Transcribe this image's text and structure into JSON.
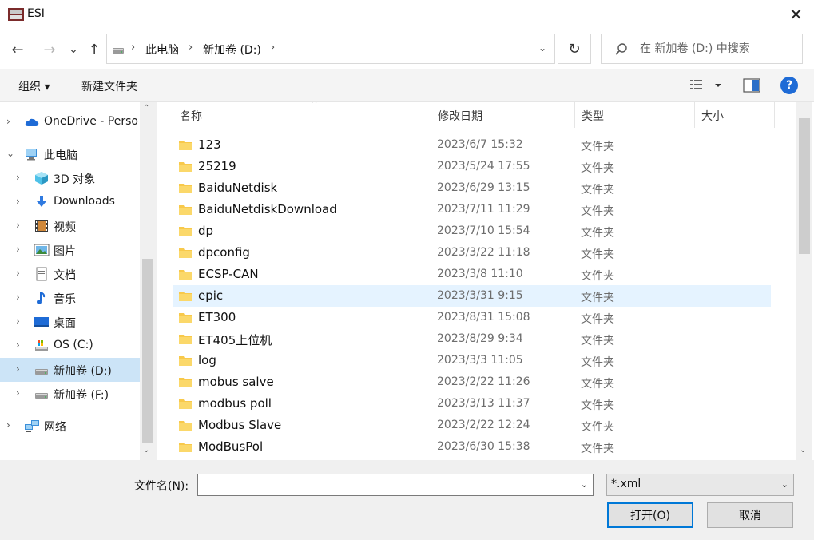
{
  "window": {
    "title": "ESI",
    "close": "✕"
  },
  "nav": {
    "back": "←",
    "forward": "→",
    "history": "⌄",
    "up": "↑",
    "crumbs": [
      "此电脑",
      "新加卷 (D:)"
    ],
    "refresh": "↻",
    "search_placeholder": "在 新加卷 (D:) 中搜索"
  },
  "toolbar": {
    "organize": "组织 ▾",
    "new_folder": "新建文件夹",
    "help": "?"
  },
  "tree": {
    "items": [
      {
        "label": "OneDrive - Perso",
        "chev": "›",
        "icon": "cloud-icon"
      },
      {
        "label": "此电脑",
        "chev": "⌄",
        "icon": "computer-icon"
      },
      {
        "label": "3D 对象",
        "chev": "›",
        "icon": "cube-icon"
      },
      {
        "label": "Downloads",
        "chev": "›",
        "icon": "download-icon"
      },
      {
        "label": "视频",
        "chev": "›",
        "icon": "video-icon"
      },
      {
        "label": "图片",
        "chev": "›",
        "icon": "picture-icon"
      },
      {
        "label": "文档",
        "chev": "›",
        "icon": "document-icon"
      },
      {
        "label": "音乐",
        "chev": "›",
        "icon": "music-icon"
      },
      {
        "label": "桌面",
        "chev": "›",
        "icon": "desktop-icon"
      },
      {
        "label": "OS (C:)",
        "chev": "›",
        "icon": "drive-c-icon"
      },
      {
        "label": "新加卷 (D:)",
        "chev": "›",
        "icon": "drive-icon"
      },
      {
        "label": "新加卷 (F:)",
        "chev": "›",
        "icon": "drive-icon"
      },
      {
        "label": "网络",
        "chev": "›",
        "icon": "network-icon"
      }
    ]
  },
  "list": {
    "headers": {
      "name": "名称",
      "date": "修改日期",
      "type": "类型",
      "size": "大小"
    },
    "rows": [
      {
        "name": "123",
        "date": "2023/6/7 15:32",
        "type": "文件夹"
      },
      {
        "name": "25219",
        "date": "2023/5/24 17:55",
        "type": "文件夹"
      },
      {
        "name": "BaiduNetdisk",
        "date": "2023/6/29 13:15",
        "type": "文件夹"
      },
      {
        "name": "BaiduNetdiskDownload",
        "date": "2023/7/11 11:29",
        "type": "文件夹"
      },
      {
        "name": "dp",
        "date": "2023/7/10 15:54",
        "type": "文件夹"
      },
      {
        "name": "dpconfig",
        "date": "2023/3/22 11:18",
        "type": "文件夹"
      },
      {
        "name": "ECSP-CAN",
        "date": "2023/3/8 11:10",
        "type": "文件夹"
      },
      {
        "name": "epic",
        "date": "2023/3/31 9:15",
        "type": "文件夹"
      },
      {
        "name": "ET300",
        "date": "2023/8/31 15:08",
        "type": "文件夹"
      },
      {
        "name": "ET405上位机",
        "date": "2023/8/29 9:34",
        "type": "文件夹"
      },
      {
        "name": "log",
        "date": "2023/3/3 11:05",
        "type": "文件夹"
      },
      {
        "name": "mobus  salve",
        "date": "2023/2/22 11:26",
        "type": "文件夹"
      },
      {
        "name": "modbus poll",
        "date": "2023/3/13 11:37",
        "type": "文件夹"
      },
      {
        "name": "Modbus Slave",
        "date": "2023/2/22 12:24",
        "type": "文件夹"
      },
      {
        "name": "ModBusPol",
        "date": "2023/6/30 15:38",
        "type": "文件夹"
      }
    ]
  },
  "bottom": {
    "filename_label": "文件名(N):",
    "filename_value": "",
    "filter_value": "*.xml",
    "open_label": "打开(O)",
    "cancel_label": "取消"
  },
  "colors": {
    "accent": "#0078d7",
    "selection": "#cce4f7",
    "hover": "#e5f3ff",
    "folder": "#f8c94b"
  }
}
